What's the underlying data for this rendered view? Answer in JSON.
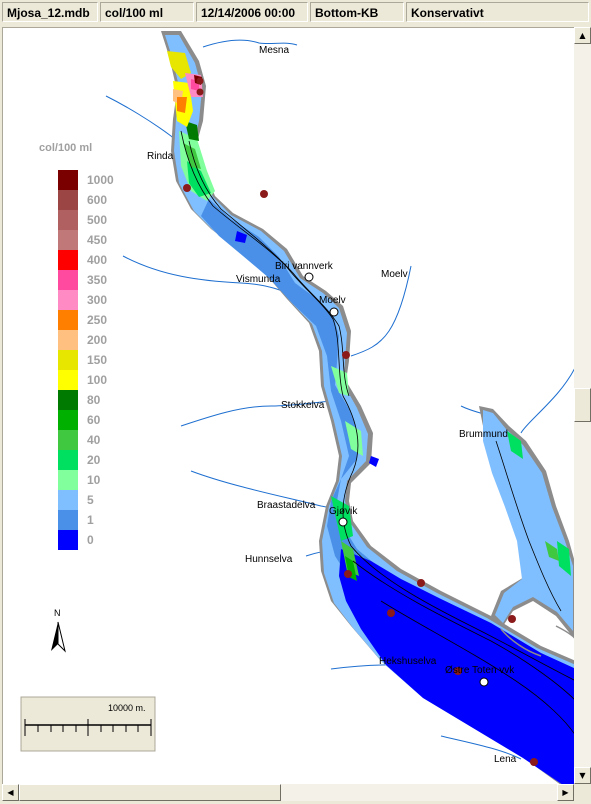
{
  "statusbar": {
    "file": "Mjosa_12.mdb",
    "unit": "col/100 ml",
    "datetime": "12/14/2006 00:00",
    "layer": "Bottom-KB",
    "scenario": "Konservativt"
  },
  "legend": {
    "title": "col/100 ml",
    "classes": [
      {
        "label": "1000",
        "color": "#7a0000"
      },
      {
        "label": "600",
        "color": "#9c4545"
      },
      {
        "label": "500",
        "color": "#b06060"
      },
      {
        "label": "450",
        "color": "#c07878"
      },
      {
        "label": "400",
        "color": "#ff0000"
      },
      {
        "label": "350",
        "color": "#ff4aa0"
      },
      {
        "label": "300",
        "color": "#ff8ac4"
      },
      {
        "label": "250",
        "color": "#ff8000"
      },
      {
        "label": "200",
        "color": "#ffc080"
      },
      {
        "label": "150",
        "color": "#e6e600"
      },
      {
        "label": "100",
        "color": "#ffff00"
      },
      {
        "label": "80",
        "color": "#007a00"
      },
      {
        "label": "60",
        "color": "#00b000"
      },
      {
        "label": "40",
        "color": "#40c840"
      },
      {
        "label": "20",
        "color": "#00e060"
      },
      {
        "label": "10",
        "color": "#80ff9c"
      },
      {
        "label": "5",
        "color": "#80bfff"
      },
      {
        "label": "1",
        "color": "#4a90e8"
      },
      {
        "label": "0",
        "color": "#0000ff"
      }
    ]
  },
  "place_labels": {
    "mesna": "Mesna",
    "rinda": "Rinda",
    "biri": "Biri vannverk",
    "vismunda": "Vismunda",
    "moelv_river": "Moelv",
    "moelv_town": "Moelv",
    "stokkelva": "Stokkelva",
    "brummund": "Brummund",
    "braastadelva": "Braastadelva",
    "gjovik": "Gjøvik",
    "hunnselva": "Hunnselva",
    "hekshuselva": "Hekshuselva",
    "ostre_toten": "Østre Toten vvk",
    "lena": "Lena"
  },
  "north_arrow": {
    "label": "N"
  },
  "scale_bar": {
    "label": "10000 m."
  },
  "scrollbar_glyphs": {
    "up": "▲",
    "down": "▼",
    "left": "◀",
    "right": "▶"
  }
}
